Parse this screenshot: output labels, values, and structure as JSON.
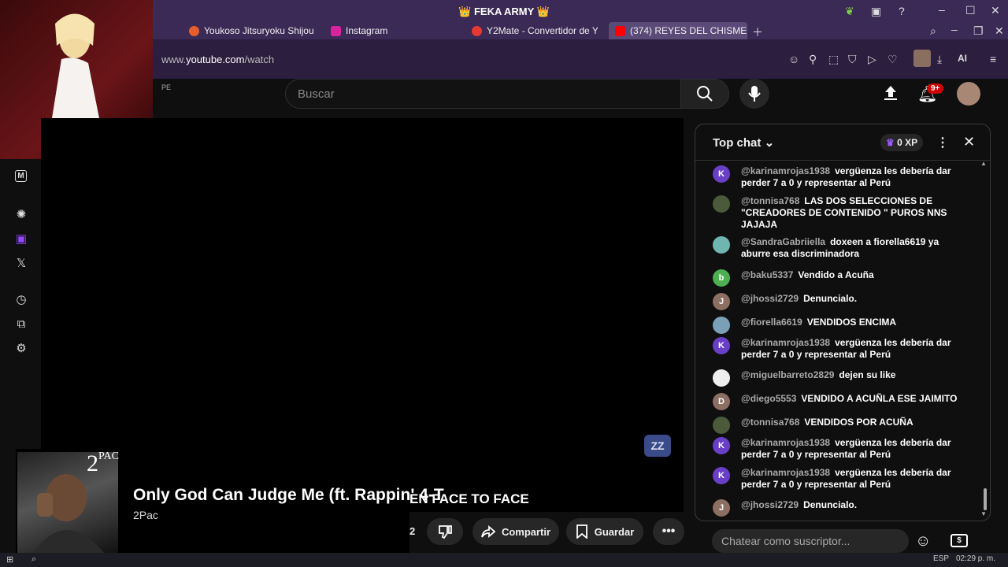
{
  "browser": {
    "window_title": "👑 FEKA ARMY 👑",
    "tabs": [
      {
        "label": "Youkoso Jitsuryoku Shijou",
        "color": "#e85d2a"
      },
      {
        "label": "Instagram",
        "color": "#d6249f"
      },
      {
        "label": "Y2Mate - Convertidor de Y",
        "color": "#e53935"
      },
      {
        "label": "(374) REYES DEL CHISME",
        "color": "#ff0000"
      }
    ],
    "url_prefix": "www.",
    "url_host": "youtube.com",
    "url_path": "/watch",
    "ai_label": "AI"
  },
  "youtube": {
    "search_placeholder": "Buscar",
    "notification_count": "9+",
    "region_code": "PE"
  },
  "player": {
    "caption": "EN FACE TO FACE",
    "watermark": "ZZ"
  },
  "now_playing": {
    "album_label": "2",
    "album_label_suffix": "PAC",
    "title": "Only God Can Judge Me (ft. Rappin' 4-T",
    "artist": "2Pac"
  },
  "actions": {
    "like_count": "2",
    "share_label": "Compartir",
    "save_label": "Guardar"
  },
  "chat": {
    "title": "Top chat",
    "xp": "0 XP",
    "input_placeholder": "Chatear como suscriptor...",
    "messages": [
      {
        "author": "@karinamrojas1938",
        "text": "vergüenza les debería dar perder 7 a 0 y representar al Perú",
        "avatar": "K",
        "color": "#6a3fc7"
      },
      {
        "author": "@tonnisa768",
        "text": "LAS DOS SELECCIONES DE \"CREADORES DE CONTENIDO \" PUROS NNS JAJAJA",
        "avatar": "",
        "color": "#4a5a3a"
      },
      {
        "author": "@SandraGabriiella",
        "text": "doxeen a fiorella6619 ya aburre esa discriminadora",
        "avatar": "",
        "color": "#6fb6b0"
      },
      {
        "author": "@baku5337",
        "text": "Vendido a Acuña",
        "avatar": "b",
        "color": "#4caf50"
      },
      {
        "author": "@jhossi2729",
        "text": "Denuncialo.",
        "avatar": "J",
        "color": "#8d6e63"
      },
      {
        "author": "@fiorella6619",
        "text": "VENDIDOS ENCIMA",
        "avatar": "",
        "color": "#7aa0b8"
      },
      {
        "author": "@karinamrojas1938",
        "text": "vergüenza les debería dar perder 7 a 0 y representar al Perú",
        "avatar": "K",
        "color": "#6a3fc7"
      },
      {
        "author": "@miguelbarreto2829",
        "text": "dejen su like",
        "avatar": "",
        "color": "#eeeeee"
      },
      {
        "author": "@diego5553",
        "text": "VENDIDO A ACUÑLA ESE JAIMITO",
        "avatar": "D",
        "color": "#8d6e63"
      },
      {
        "author": "@tonnisa768",
        "text": "VENDIDOS POR ACUÑA",
        "avatar": "",
        "color": "#4a5a3a"
      },
      {
        "author": "@karinamrojas1938",
        "text": "vergüenza les debería dar perder 7 a 0 y representar al Perú",
        "avatar": "K",
        "color": "#6a3fc7"
      },
      {
        "author": "@karinamrojas1938",
        "text": "vergüenza les debería dar perder 7 a 0 y representar al Perú",
        "avatar": "K",
        "color": "#6a3fc7"
      },
      {
        "author": "@jhossi2729",
        "text": "Denuncialo.",
        "avatar": "J",
        "color": "#8d6e63"
      }
    ]
  },
  "taskbar": {
    "lang": "ESP",
    "clock": "02:29 p. m."
  }
}
